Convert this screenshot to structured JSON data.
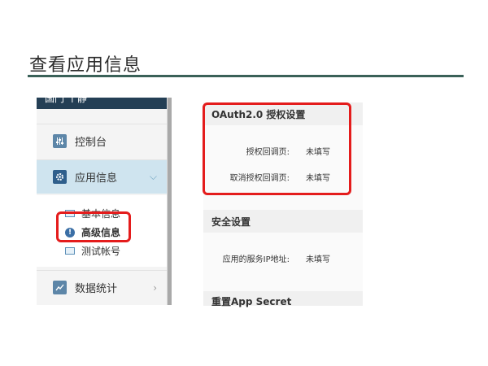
{
  "page": {
    "title": "查看应用信息"
  },
  "sidebar": {
    "header_text": "国门 丨静",
    "items": [
      {
        "label": "控制台",
        "icon": "sliders-icon"
      },
      {
        "label": "应用信息",
        "icon": "gear-icon",
        "active": true
      },
      {
        "label": "数据统计",
        "icon": "chart-icon"
      }
    ],
    "sub_items": [
      {
        "label": "基本信息"
      },
      {
        "label": "高级信息",
        "selected": true
      },
      {
        "label": "测试帐号"
      }
    ]
  },
  "panel": {
    "oauth": {
      "title": "OAuth2.0 授权设置",
      "rows": [
        {
          "key": "授权回调页:",
          "value": "未填写"
        },
        {
          "key": "取消授权回调页:",
          "value": "未填写"
        }
      ]
    },
    "security": {
      "title": "安全设置",
      "rows": [
        {
          "key": "应用的服务IP地址:",
          "value": "未填写"
        }
      ]
    },
    "reset": {
      "title": "重置App Secret"
    }
  },
  "colors": {
    "accent_rule": "#3a6158",
    "sidebar_header": "#243f55",
    "highlight": "#e41c1c",
    "active_nav": "#cfe4ef"
  }
}
